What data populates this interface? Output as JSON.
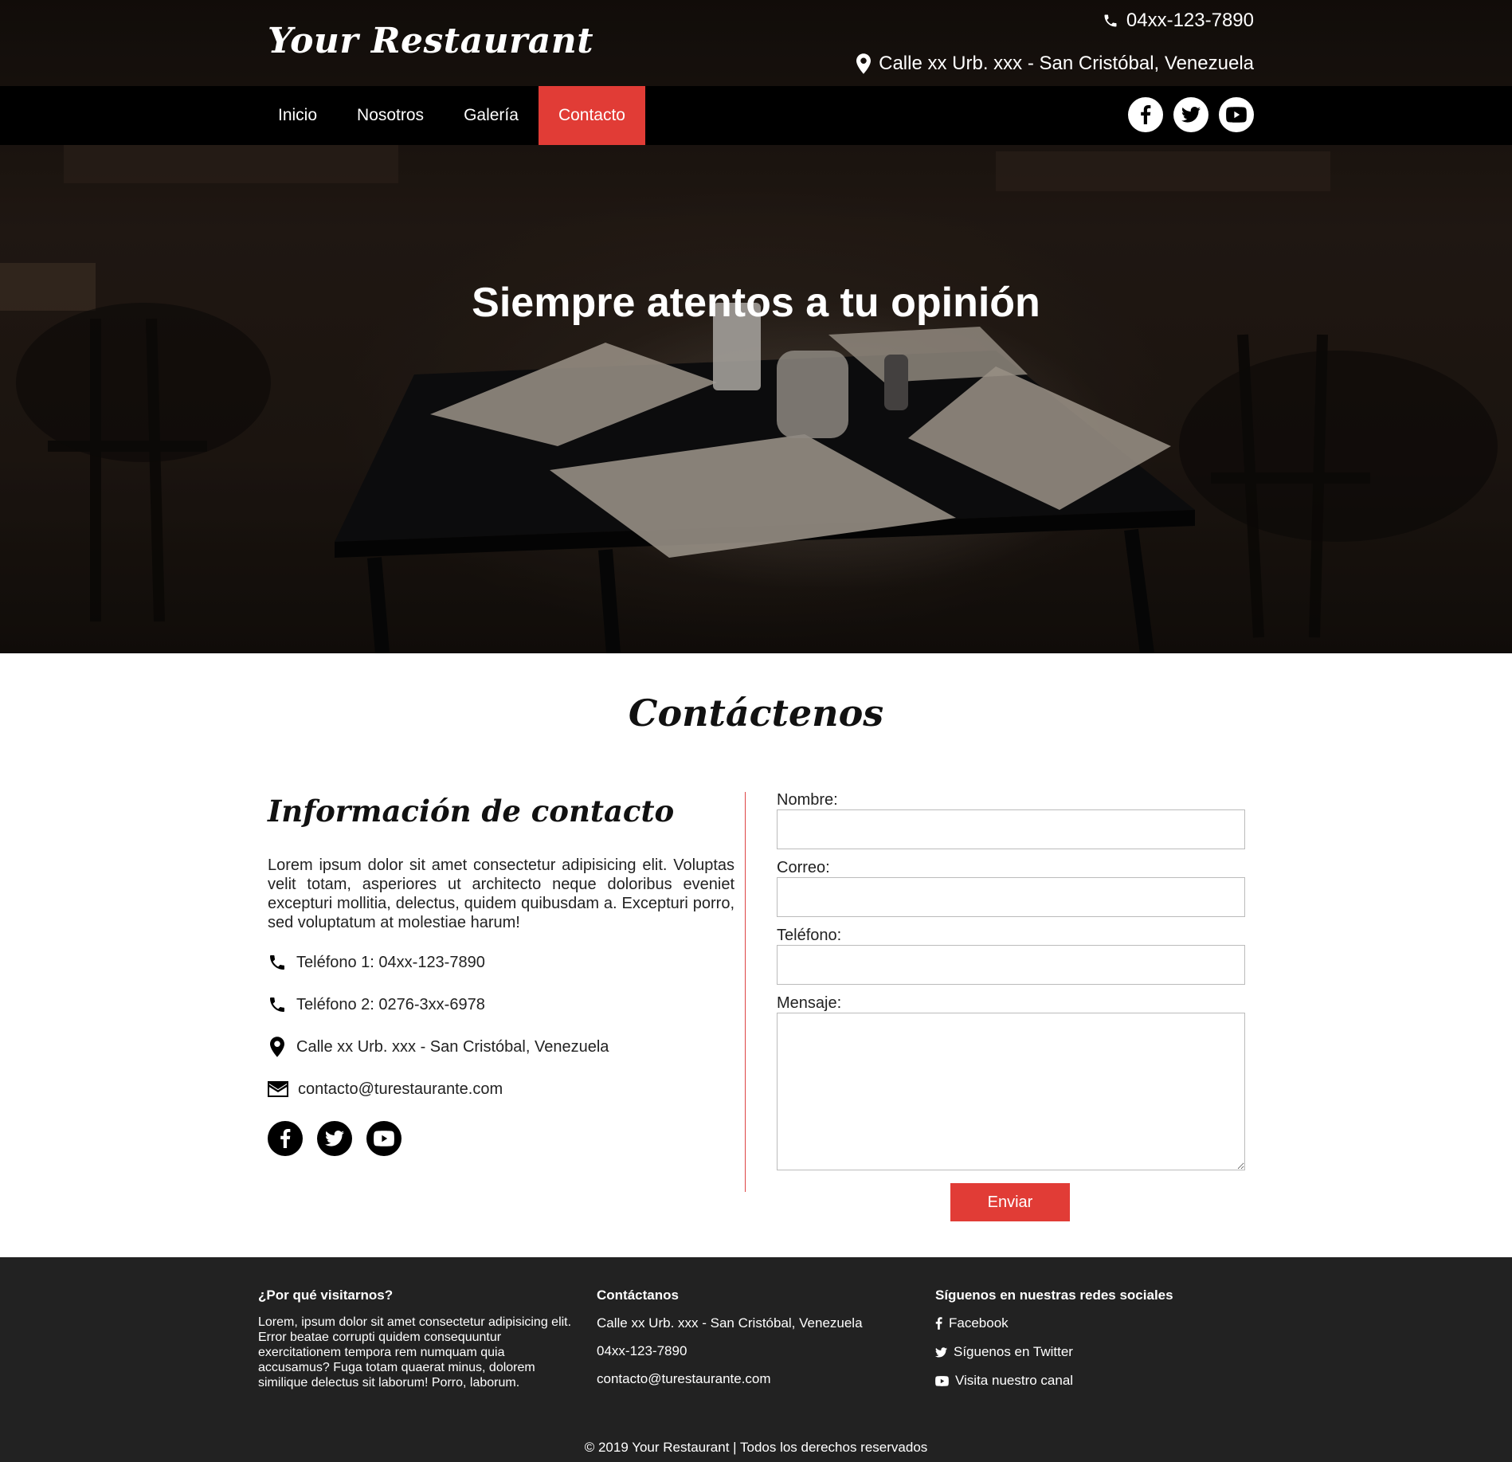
{
  "header": {
    "brand": "Your Restaurant",
    "phone": "04xx-123-7890",
    "address": "Calle xx Urb. xxx - San Cristóbal, Venezuela"
  },
  "nav": {
    "items": [
      {
        "label": "Inicio",
        "active": false
      },
      {
        "label": "Nosotros",
        "active": false
      },
      {
        "label": "Galería",
        "active": false
      },
      {
        "label": "Contacto",
        "active": true
      }
    ],
    "social_icons": [
      "facebook-icon",
      "twitter-icon",
      "youtube-icon"
    ]
  },
  "hero": {
    "title": "Siempre atentos a tu opinión"
  },
  "contact": {
    "section_title": "Contáctenos",
    "info_title": "Información de contacto",
    "info_text": "Lorem ipsum dolor sit amet consectetur adipisicing elit. Voluptas velit totam, asperiores ut architecto neque doloribus eveniet excepturi mollitia, delectus, quidem quibusdam a. Excepturi porro, sed voluptatum at molestiae harum!",
    "phone1": "Teléfono 1: 04xx-123-7890",
    "phone2": "Teléfono 2: 0276-3xx-6978",
    "address": "Calle xx Urb. xxx - San Cristóbal, Venezuela",
    "email": "contacto@turestaurante.com"
  },
  "form": {
    "name_label": "Nombre:",
    "email_label": "Correo:",
    "phone_label": "Teléfono:",
    "message_label": "Mensaje:",
    "name_value": "",
    "email_value": "",
    "phone_value": "",
    "message_value": "",
    "submit_label": "Enviar"
  },
  "footer": {
    "about_title": "¿Por qué visitarnos?",
    "about_text": "Lorem, ipsum dolor sit amet consectetur adipisicing elit. Error beatae corrupti quidem consequuntur exercitationem tempora rem numquam quia accusamus? Fuga totam quaerat minus, dolorem similique delectus sit laborum! Porro, laborum.",
    "contact_title": "Contáctanos",
    "contact_address": "Calle xx Urb. xxx - San Cristóbal, Venezuela",
    "contact_phone": "04xx-123-7890",
    "contact_email": "contacto@turestaurante.com",
    "social_title": "Síguenos en nuestras redes sociales",
    "facebook": "Facebook",
    "twitter": "Síguenos en Twitter",
    "youtube": "Visita nuestro canal",
    "copyright": "© 2019 Your Restaurant | Todos los derechos reservados"
  },
  "colors": {
    "accent": "#e13c36",
    "nav_bg": "#000000",
    "footer_bg": "#222222"
  }
}
